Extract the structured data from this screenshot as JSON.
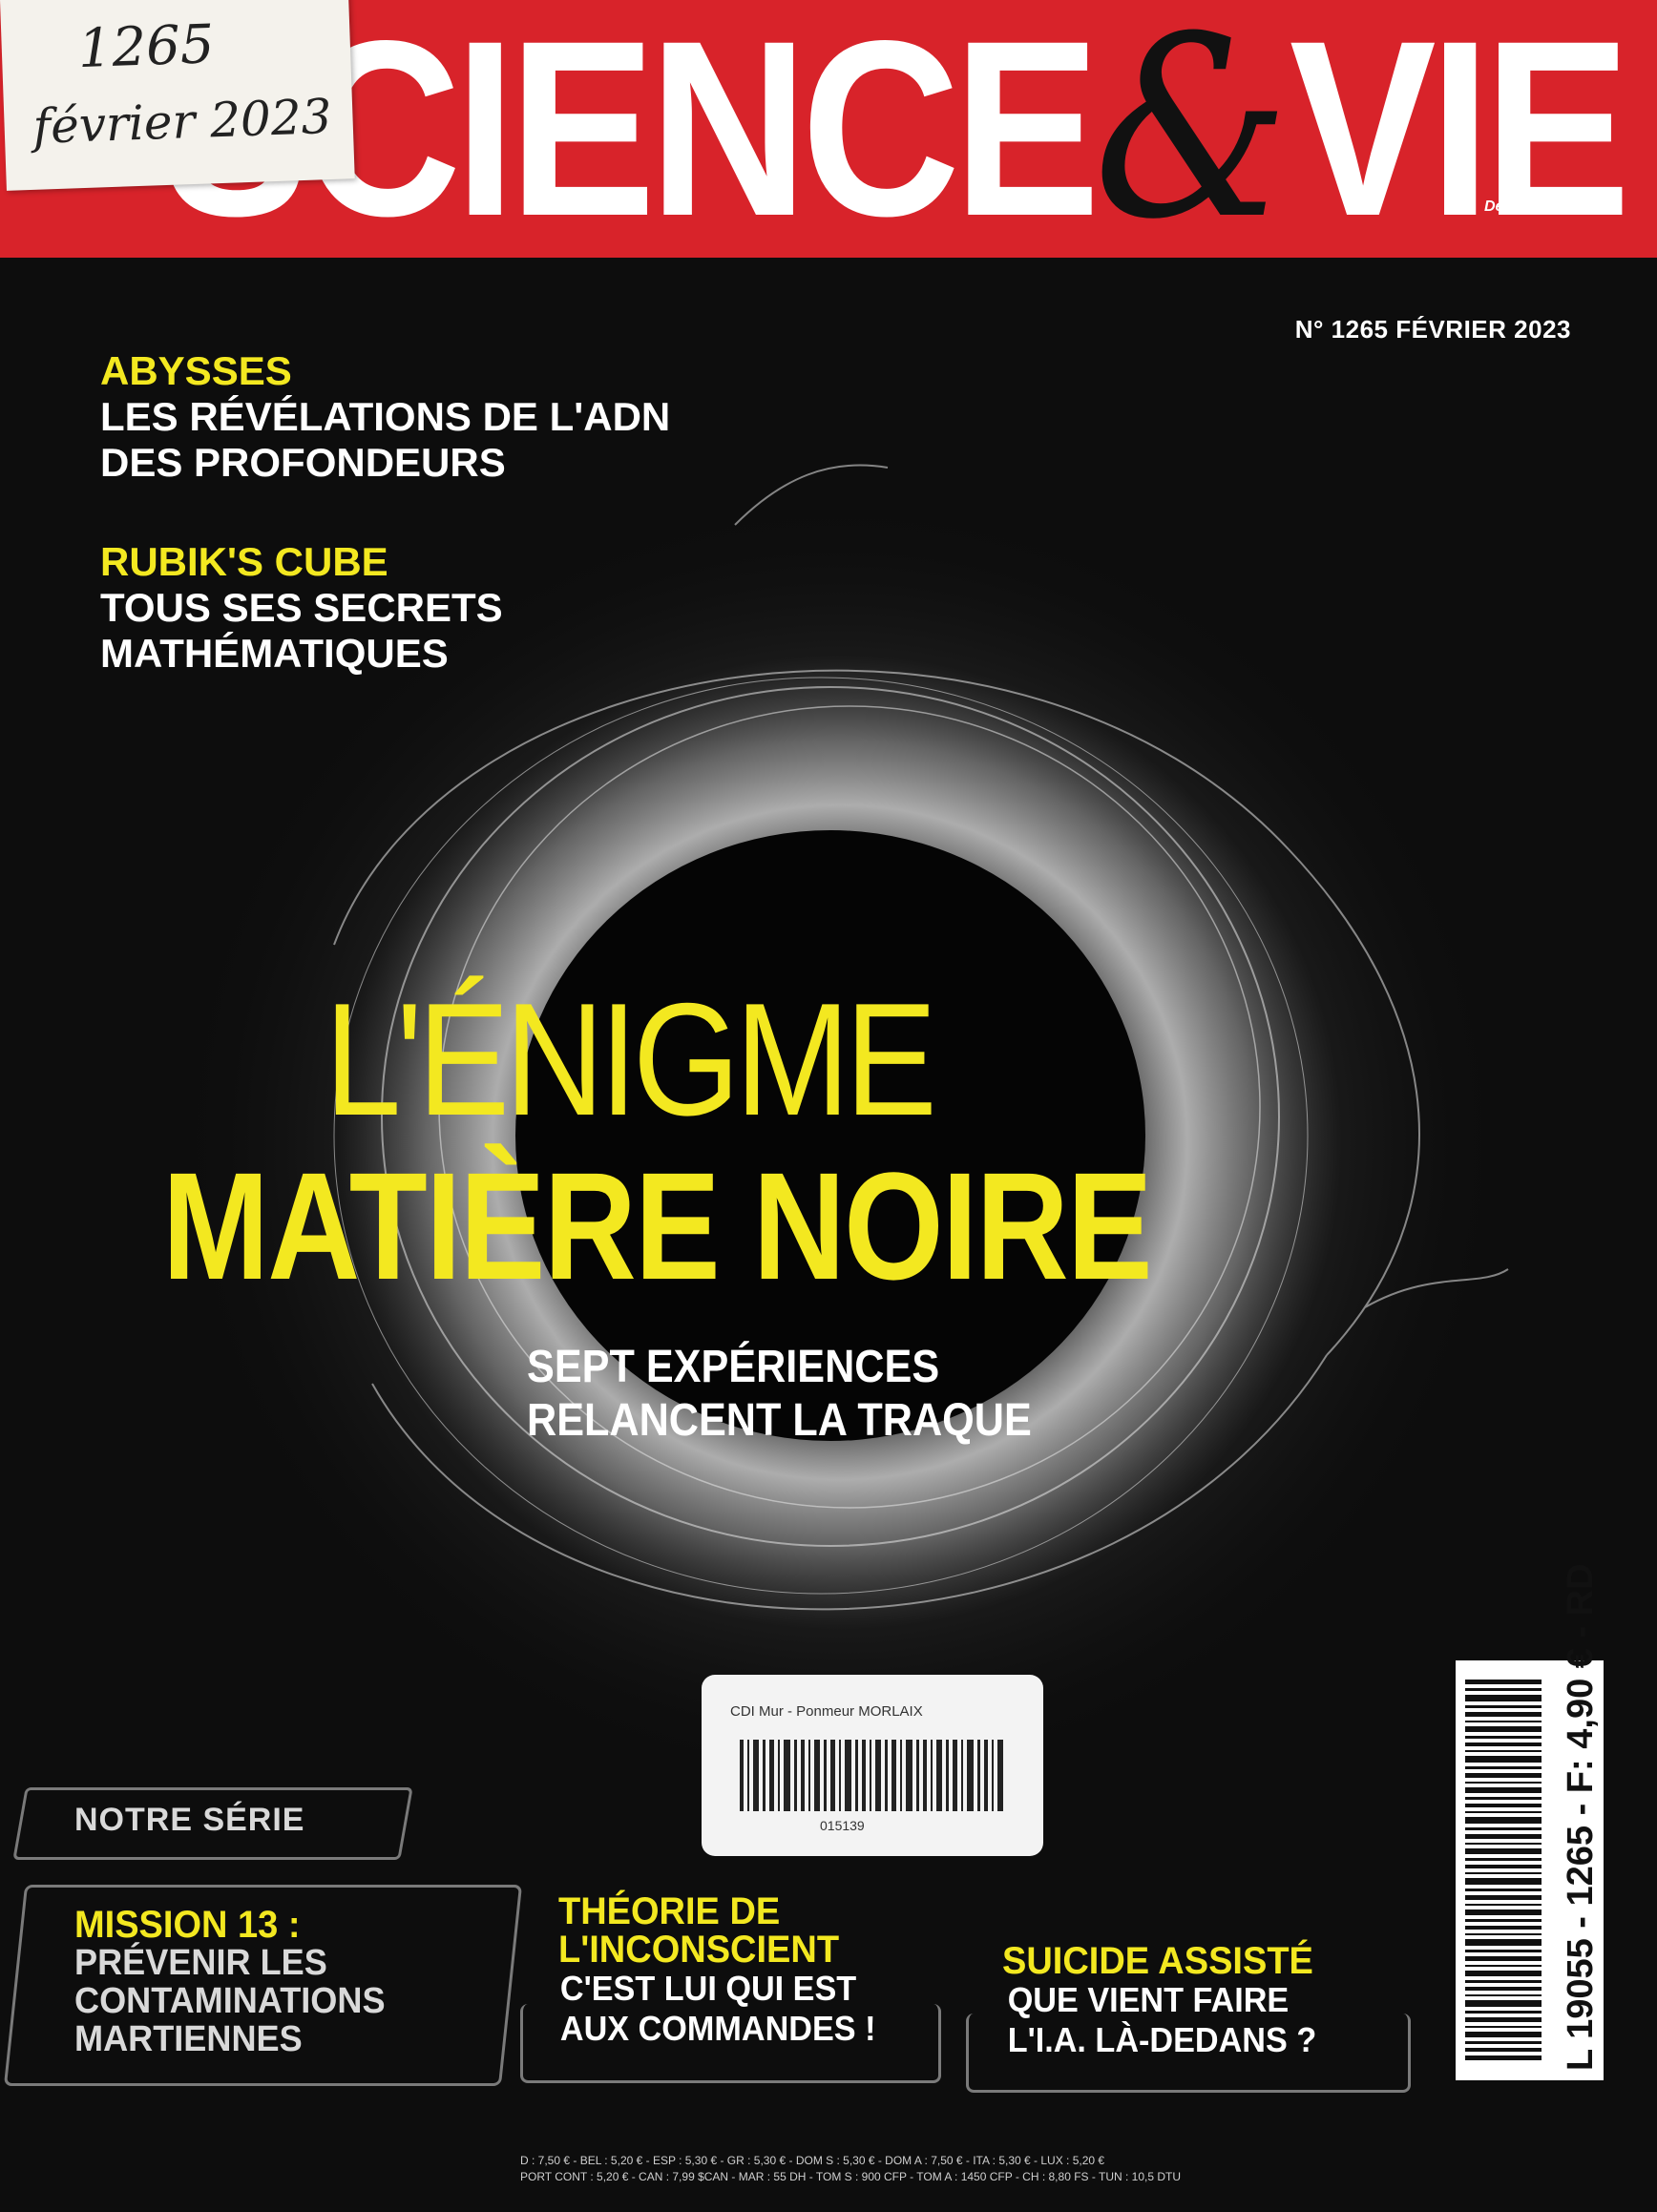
{
  "handwritten_note": {
    "line1": "1265",
    "line2": "février 2023"
  },
  "masthead": {
    "logo_main": "SCIENCE",
    "logo_amp": "&",
    "logo_end": "VIE",
    "since": "Depuis 1913",
    "brand_color": "#d8232a"
  },
  "issue": "N° 1265 FÉVRIER 2023",
  "teasers": [
    {
      "kicker": "ABYSSES",
      "lines": [
        "LES RÉVÉLATIONS DE L'ADN",
        "DES PROFONDEURS"
      ]
    },
    {
      "kicker": "RUBIK'S CUBE",
      "lines": [
        "TOUS SES SECRETS",
        "MATHÉMATIQUES"
      ]
    }
  ],
  "headline": {
    "line1": "L'ÉNIGME",
    "line2": "MATIÈRE NOIRE",
    "sub1": "SEPT EXPÉRIENCES",
    "sub2": "RELANCENT LA TRAQUE",
    "color": "#f3e820"
  },
  "library_sticker": {
    "title": "CDI Mur - Ponmeur MORLAIX",
    "code": "015139"
  },
  "bottom": {
    "series_tag": "NOTRE SÉRIE",
    "box1": {
      "kicker1": "MISSION 13 :",
      "lines": [
        "PRÉVENIR LES",
        "CONTAMINATIONS",
        "MARTIENNES"
      ]
    },
    "box2": {
      "kicker_lines": [
        "THÉORIE DE",
        "L'INCONSCIENT"
      ],
      "lines": [
        "C'EST LUI QUI EST",
        "AUX COMMANDES !"
      ]
    },
    "box3": {
      "kicker": "SUICIDE ASSISTÉ",
      "lines": [
        "QUE VIENT FAIRE",
        "L'I.A. LÀ-DEDANS ?"
      ]
    }
  },
  "barcode_text": "L 19055 - 1265 - F: 4,90 € - RD",
  "prices": {
    "line1": "D : 7,50 € - BEL : 5,20 € - ESP : 5,30 € - GR : 5,30 € - DOM S : 5,30 € - DOM A : 7,50 € - ITA : 5,30 € - LUX : 5,20 €",
    "line2": "PORT CONT : 5,20 € - CAN : 7,99 $CAN - MAR : 55 DH - TOM S : 900 CFP - TOM A : 1450 CFP - CH : 8,80 FS - TUN : 10,5 DTU"
  }
}
